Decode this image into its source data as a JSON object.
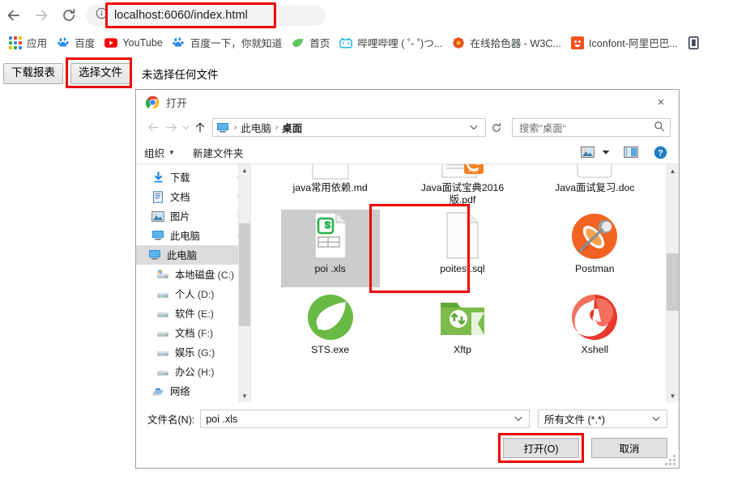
{
  "browser": {
    "nav": {
      "back": "back-arrow",
      "forward": "forward-arrow",
      "reload": "reload"
    },
    "omnibox": {
      "url": "localhost:6060/index.html",
      "security_icon": "info-circle-icon"
    },
    "bookmarks": [
      {
        "label": "应用",
        "icon": "apps-grid-icon"
      },
      {
        "label": "百度",
        "icon": "baidu-paw-icon"
      },
      {
        "label": "YouTube",
        "icon": "youtube-icon"
      },
      {
        "label": "百度一下，你就知道",
        "icon": "baidu-paw-icon"
      },
      {
        "label": "首页",
        "icon": "green-leaf-icon"
      },
      {
        "label": "哔哩哔哩 ( ˚- ˚)つ...",
        "icon": "bilibili-icon"
      },
      {
        "label": "在线拾色器 - W3C...",
        "icon": "color-picker-icon"
      },
      {
        "label": "Iconfont-阿里巴巴...",
        "icon": "iconfont-icon"
      }
    ]
  },
  "page": {
    "download_button": "下载报表",
    "choose_file_button": "选择文件",
    "no_file_text": "未选择任何文件"
  },
  "dialog": {
    "title": "打开",
    "title_icon": "chrome-icon",
    "close": "×",
    "breadcrumb": {
      "root_icon": "this-pc-icon",
      "parts": [
        "此电脑",
        "桌面"
      ],
      "separator": "›"
    },
    "search": {
      "placeholder": "搜索\"桌面\"",
      "icon": "search-icon"
    },
    "toolbar": {
      "organize": "组织",
      "new_folder": "新建文件夹",
      "caret": "▼",
      "view_icon": "view-icon",
      "pane_icon": "preview-pane-icon",
      "help_icon": "help-icon"
    },
    "tree": {
      "quick": [
        {
          "label": "下载",
          "icon": "download-arrow-icon",
          "pinned": true
        },
        {
          "label": "文档",
          "icon": "documents-icon",
          "pinned": true
        },
        {
          "label": "图片",
          "icon": "pictures-icon",
          "pinned": true
        },
        {
          "label": "此电脑",
          "icon": "this-pc-icon",
          "pinned": true
        }
      ],
      "this_pc": {
        "label": "此电脑",
        "icon": "this-pc-icon"
      },
      "drives": [
        {
          "label": "本地磁盘",
          "drive": "(C:)",
          "icon": "system-drive-icon"
        },
        {
          "label": "个人",
          "drive": "(D:)",
          "icon": "drive-icon"
        },
        {
          "label": "软件",
          "drive": "(E:)",
          "icon": "drive-icon"
        },
        {
          "label": "文档",
          "drive": "(F:)",
          "icon": "drive-icon"
        },
        {
          "label": "娱乐",
          "drive": "(G:)",
          "icon": "drive-icon"
        },
        {
          "label": "办公",
          "drive": "(H:)",
          "icon": "drive-icon"
        }
      ],
      "network": {
        "label": "网络",
        "icon": "network-icon"
      }
    },
    "files": [
      {
        "name": "java常用依赖.md",
        "icon": "md-file-icon",
        "selected": false
      },
      {
        "name": "Java面试宝典2016版.pdf",
        "icon": "pdf-file-icon",
        "selected": false
      },
      {
        "name": "Java面试复习.doc",
        "icon": "doc-file-icon",
        "selected": false
      },
      {
        "name": "poi .xls",
        "icon": "xls-file-icon",
        "selected": true
      },
      {
        "name": "poitest.sql",
        "icon": "blank-file-icon",
        "selected": false
      },
      {
        "name": "Postman",
        "icon": "postman-icon",
        "selected": false
      },
      {
        "name": "STS.exe",
        "icon": "spring-sts-icon",
        "selected": false
      },
      {
        "name": "Xftp",
        "icon": "xftp-icon",
        "selected": false
      },
      {
        "name": "Xshell",
        "icon": "xshell-icon",
        "selected": false
      }
    ],
    "filename": {
      "label": "文件名(N):",
      "value": "poi .xls"
    },
    "filter": {
      "value": "所有文件 (*.*)"
    },
    "open_button": "打开(O)",
    "cancel_button": "取消"
  },
  "colors": {
    "highlight_red": "#ee0000",
    "selection_gray": "#cccccc",
    "chrome_bg": "#ffffff",
    "omnibox_bg": "#f1f3f4"
  }
}
